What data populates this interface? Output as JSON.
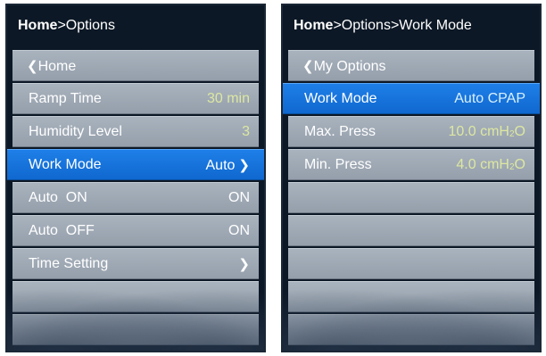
{
  "left": {
    "title_home": "Home",
    "title_rest": ">Options",
    "back_label": "Home",
    "rows": [
      {
        "label": "Ramp Time",
        "value": "30 min"
      },
      {
        "label": "Humidity Level",
        "value": "3"
      },
      {
        "label": "Work Mode",
        "value": "Auto"
      },
      {
        "label": "Auto  ON",
        "value": "ON"
      },
      {
        "label": "Auto  OFF",
        "value": "ON"
      },
      {
        "label": "Time Setting",
        "value": ""
      }
    ]
  },
  "right": {
    "title_home": "Home",
    "title_rest": ">Options>Work Mode",
    "back_label": "My Options",
    "rows": [
      {
        "label": "Work Mode",
        "value": "Auto CPAP"
      },
      {
        "label": "Max. Press",
        "value": "10.0 cmH",
        "unit_sub": "2",
        "unit_tail": "O"
      },
      {
        "label": "Min. Press",
        "value": "4.0 cmH",
        "unit_sub": "2",
        "unit_tail": "O"
      }
    ]
  },
  "colors": {
    "selected": "#1a78e0",
    "row": "#a2acb8",
    "value_green": "#dde7a0",
    "background": "#0d1826"
  },
  "icons": {
    "back": "chevron-left-icon",
    "forward": "chevron-right-icon"
  }
}
